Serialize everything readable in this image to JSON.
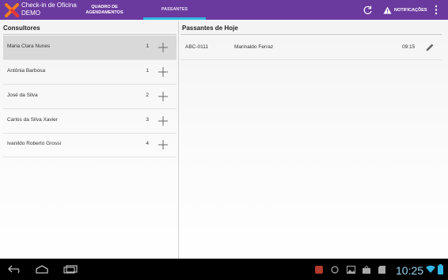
{
  "app": {
    "title_line1": "Check-in de Oficina",
    "title_line2": "DEMO",
    "brand_color": "#6b3a9e",
    "accent_color": "#33b5e5"
  },
  "tabs": [
    {
      "label": "QUADRO DE AGENDAMENTOS",
      "selected": false
    },
    {
      "label": "PASSANTES",
      "selected": true
    }
  ],
  "actions": {
    "refresh_icon": "refresh-icon",
    "notifications_label": "NOTIFICAÇÕES",
    "notifications_icon": "warning-icon",
    "overflow_icon": "overflow-menu-icon"
  },
  "consultores": {
    "title": "Consultores",
    "items": [
      {
        "name": "Maria Clara Nunes",
        "count": "1",
        "selected": true
      },
      {
        "name": "Antônia Barbosa",
        "count": "1",
        "selected": false
      },
      {
        "name": "José da Silva",
        "count": "2",
        "selected": false
      },
      {
        "name": "Carlos da Silva Xavier",
        "count": "3",
        "selected": false
      },
      {
        "name": "Ivanildo Roberto Grossi",
        "count": "4",
        "selected": false
      }
    ]
  },
  "passantes": {
    "title": "Passantes de Hoje",
    "items": [
      {
        "plate": "ABC-0111",
        "name": "Marinaldo Ferraz",
        "time": "09:15"
      }
    ]
  },
  "system_bar": {
    "clock": "10:25"
  }
}
